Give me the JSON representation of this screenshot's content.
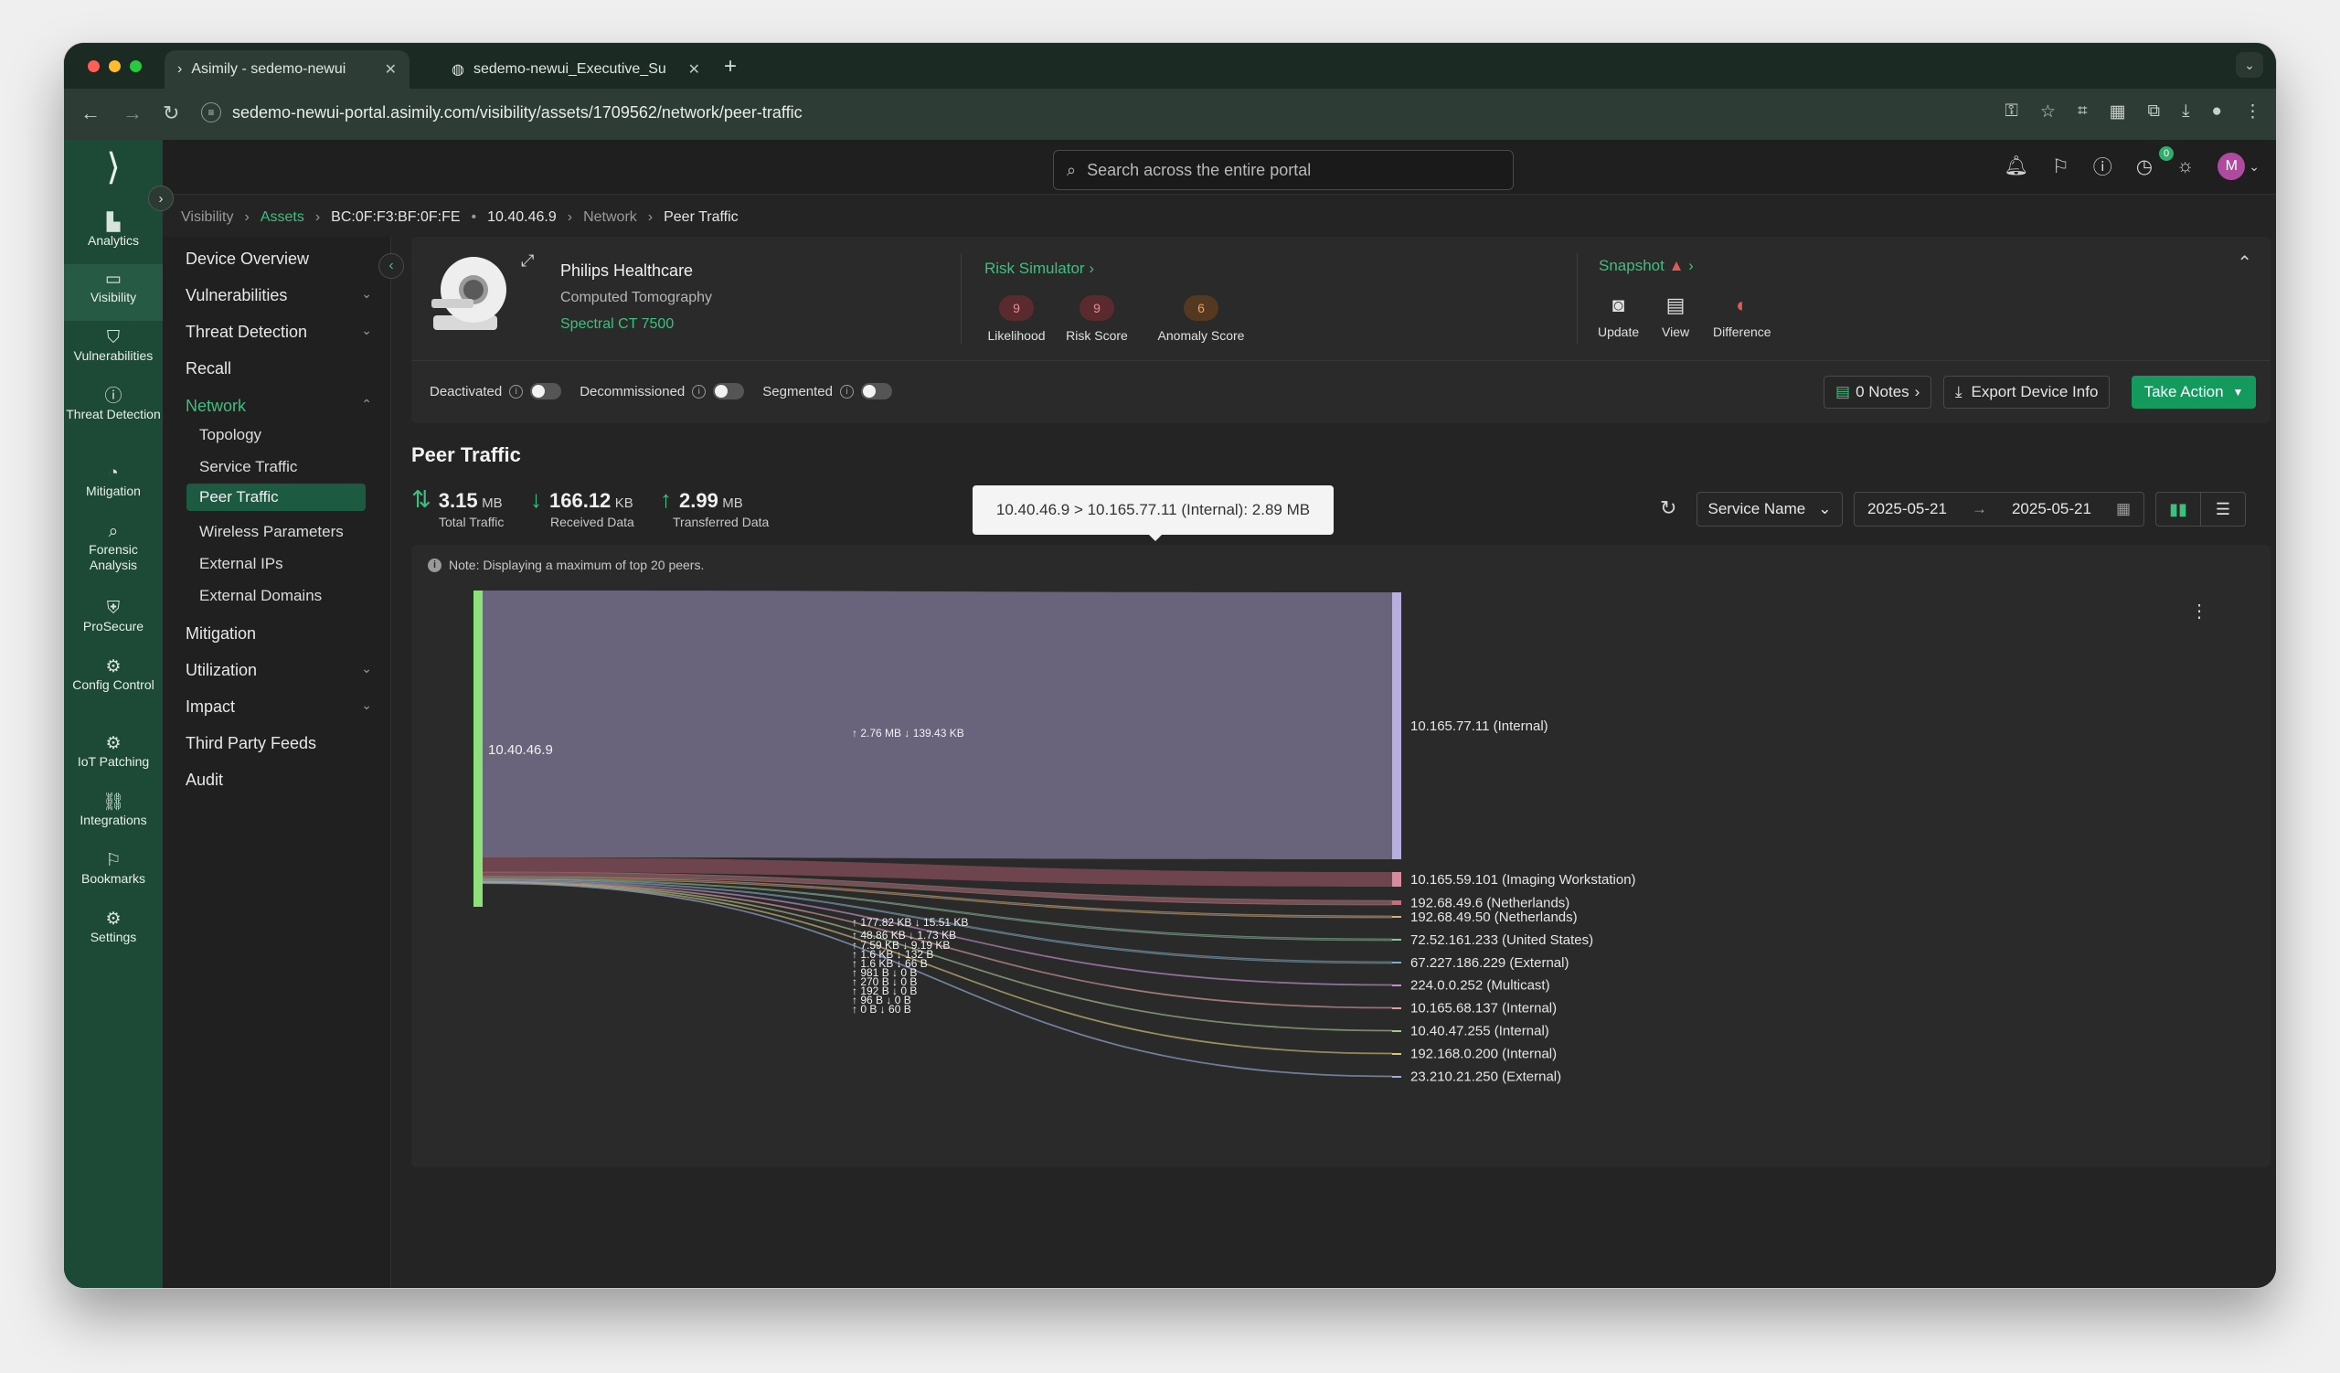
{
  "browser": {
    "tabs": [
      {
        "label": "Asimily - sedemo-newui"
      },
      {
        "label": "sedemo-newui_Executive_Su"
      }
    ],
    "url": "sedemo-newui-portal.asimily.com/visibility/assets/1709562/network/peer-traffic"
  },
  "rail": {
    "items": [
      {
        "label": "Analytics",
        "icon": "bar-chart-icon"
      },
      {
        "label": "Visibility",
        "icon": "monitor-icon"
      },
      {
        "label": "Vulnerabilities",
        "icon": "shield-alert-icon"
      },
      {
        "label": "Threat Detection",
        "icon": "alert-circle-icon"
      },
      {
        "label": "Mitigation",
        "icon": "mitigation-icon"
      },
      {
        "label": "Forensic Analysis",
        "icon": "magnifier-icon"
      },
      {
        "label": "ProSecure",
        "icon": "shield-check-icon"
      },
      {
        "label": "Config Control",
        "icon": "config-icon"
      },
      {
        "label": "IoT Patching",
        "icon": "patch-icon"
      },
      {
        "label": "Integrations",
        "icon": "link-icon"
      },
      {
        "label": "Bookmarks",
        "icon": "bookmark-icon"
      },
      {
        "label": "Settings",
        "icon": "gear-icon"
      }
    ]
  },
  "topbar": {
    "search_placeholder": "Search across the entire portal",
    "notif_count": "0",
    "avatar": "M"
  },
  "breadcrumb": {
    "visibility": "Visibility",
    "assets": "Assets",
    "mac": "BC:0F:F3:BF:0F:FE",
    "ip": "10.40.46.9",
    "network": "Network",
    "current": "Peer Traffic"
  },
  "sidenav": {
    "device_overview": "Device Overview",
    "vulnerabilities": "Vulnerabilities",
    "threat_detection": "Threat Detection",
    "recall": "Recall",
    "network": "Network",
    "topology": "Topology",
    "service_traffic": "Service Traffic",
    "peer_traffic": "Peer Traffic",
    "wireless": "Wireless Parameters",
    "external_ips": "External IPs",
    "external_domains": "External Domains",
    "mitigation": "Mitigation",
    "utilization": "Utilization",
    "impact": "Impact",
    "third_party": "Third Party Feeds",
    "audit": "Audit"
  },
  "device": {
    "manufacturer": "Philips Healthcare",
    "type": "Computed Tomography",
    "model": "Spectral CT 7500"
  },
  "risk": {
    "title": "Risk Simulator",
    "likelihood": {
      "value": "9",
      "label": "Likelihood"
    },
    "risk_score": {
      "value": "9",
      "label": "Risk Score"
    },
    "anomaly": {
      "value": "6",
      "label": "Anomaly Score"
    }
  },
  "snapshot": {
    "title": "Snapshot",
    "update": "Update",
    "view": "View",
    "difference": "Difference"
  },
  "toggles": {
    "deactivated": "Deactivated",
    "decommissioned": "Decommissioned",
    "segmented": "Segmented"
  },
  "actions": {
    "notes": "0 Notes",
    "export": "Export Device Info",
    "take_action": "Take Action"
  },
  "peer_traffic": {
    "title": "Peer Traffic",
    "total": {
      "value": "3.15",
      "unit": "MB",
      "label": "Total Traffic"
    },
    "received": {
      "value": "166.12",
      "unit": "KB",
      "label": "Received Data"
    },
    "transferred": {
      "value": "2.99",
      "unit": "MB",
      "label": "Transferred Data"
    },
    "group_by": "Service Name",
    "date_from": "2025-05-21",
    "date_to": "2025-05-21",
    "note": "Note: Displaying a maximum of top 20 peers.",
    "tooltip": "10.40.46.9 > 10.165.77.11 (Internal): 2.89 MB"
  },
  "chart_data": {
    "type": "sankey",
    "source": "10.40.46.9",
    "targets": [
      {
        "name": "10.165.77.11 (Internal)",
        "up": "2.76 MB",
        "down": "139.43 KB",
        "color": "#b9aee0"
      },
      {
        "name": "10.165.59.101 (Imaging Workstation)",
        "up": "177.82 KB",
        "down": "15.51 KB",
        "color": "#d88a9e"
      },
      {
        "name": "192.68.49.6 (Netherlands)",
        "up": "48.86 KB",
        "down": "1.73 KB",
        "color": "#d06a78"
      },
      {
        "name": "192.68.49.50 (Netherlands)",
        "up": "7.59 KB",
        "down": "9.19 KB",
        "color": "#d9b07a"
      },
      {
        "name": "72.52.161.233 (United States)",
        "up": "1.6 KB",
        "down": "132 B",
        "color": "#8fc5a0"
      },
      {
        "name": "67.227.186.229 (External)",
        "up": "1.6 KB",
        "down": "66 B",
        "color": "#7ab0c8"
      },
      {
        "name": "224.0.0.252 (Multicast)",
        "up": "981 B",
        "down": "0 B",
        "color": "#c48fd0"
      },
      {
        "name": "10.165.68.137 (Internal)",
        "up": "270 B",
        "down": "0 B",
        "color": "#e0a0a0"
      },
      {
        "name": "10.40.47.255 (Internal)",
        "up": "192 B",
        "down": "0 B",
        "color": "#a8c88a"
      },
      {
        "name": "192.168.0.200 (Internal)",
        "up": "96 B",
        "down": "0 B",
        "color": "#d8c77a"
      },
      {
        "name": "23.210.21.250 (External)",
        "up": "0 B",
        "down": "60 B",
        "color": "#9ab0d8"
      }
    ]
  }
}
